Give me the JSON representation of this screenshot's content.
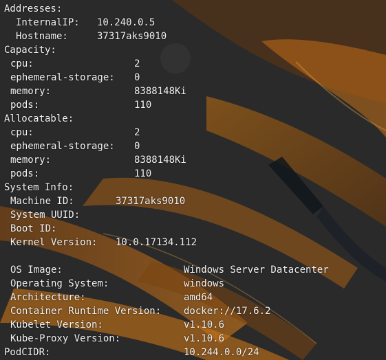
{
  "sections": {
    "addresses": "Addresses:",
    "capacity": "Capacity:",
    "allocatable": "Allocatable:",
    "system_info": "System Info:"
  },
  "addresses": [
    {
      "key": "InternalIP:",
      "value": "10.240.0.5"
    },
    {
      "key": "Hostname:",
      "value": "37317aks9010"
    }
  ],
  "capacity": [
    {
      "key": "cpu:",
      "value": "2"
    },
    {
      "key": "ephemeral-storage:",
      "value": "0"
    },
    {
      "key": "memory:",
      "value": "8388148Ki"
    },
    {
      "key": "pods:",
      "value": "110"
    }
  ],
  "allocatable": [
    {
      "key": "cpu:",
      "value": "2"
    },
    {
      "key": "ephemeral-storage:",
      "value": "0"
    },
    {
      "key": "memory:",
      "value": "8388148Ki"
    },
    {
      "key": "pods:",
      "value": "110"
    }
  ],
  "system_info": [
    {
      "key": "Machine ID:",
      "value": "37317aks9010"
    },
    {
      "key": "System UUID:",
      "value": ""
    },
    {
      "key": "Boot ID:",
      "value": ""
    },
    {
      "key": "Kernel Version:",
      "value": "10.0.17134.112"
    }
  ],
  "system_info_2": [
    {
      "key": "OS Image:",
      "value": "Windows Server Datacenter"
    },
    {
      "key": "Operating System:",
      "value": "windows"
    },
    {
      "key": "Architecture:",
      "value": "amd64"
    },
    {
      "key": "Container Runtime Version:",
      "value": "docker://17.6.2"
    },
    {
      "key": "Kubelet Version:",
      "value": "v1.10.6"
    },
    {
      "key": "Kube-Proxy Version:",
      "value": "v1.10.6"
    }
  ],
  "podcidr": {
    "key": "PodCIDR:",
    "value": "10.244.0.0/24"
  },
  "colors": {
    "text": "#f2f2f2",
    "background": "#2b2b2b",
    "accent": "#e98a1e"
  },
  "background_image": "abstract-orange-leaves-wallpaper"
}
